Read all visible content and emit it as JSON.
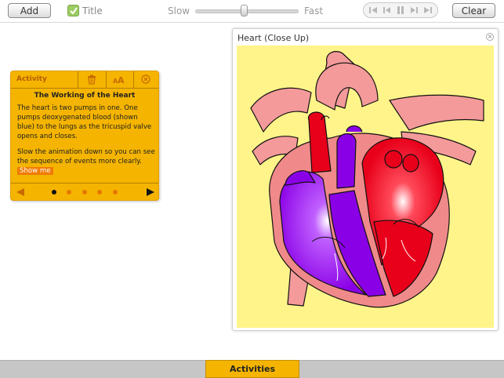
{
  "toolbar": {
    "add_label": "Add",
    "title_label": "Title",
    "title_checked": true,
    "speed_slow_label": "Slow",
    "speed_fast_label": "Fast",
    "speed_level": 0.47,
    "clear_label": "Clear",
    "playback_icons": [
      "skip-start-icon",
      "step-back-icon",
      "pause-icon",
      "step-forward-icon",
      "skip-end-icon"
    ]
  },
  "activity_panel": {
    "header_label": "Activity",
    "heading": "The Working of the Heart",
    "paragraph1": "The heart is two pumps in one. One pumps deoxygenated blood (shown blue) to the lungs as the tricuspid valve opens and closes.",
    "paragraph2": "Slow the animation down so you can see the sequence of events more clearly.",
    "show_me_label": "Show me",
    "page_count": 5,
    "current_page": 1
  },
  "heart_window": {
    "title": "Heart (Close Up)"
  },
  "bottom": {
    "activities_label": "Activities"
  },
  "colors": {
    "accent_yellow": "#f4b400",
    "show_me_orange": "#f07b00",
    "canvas_yellow": "#fff48a",
    "oxygenated_red": "#e8001a",
    "deoxygenated_purple": "#8a00e6",
    "muscle_pink": "#f08a8a"
  }
}
